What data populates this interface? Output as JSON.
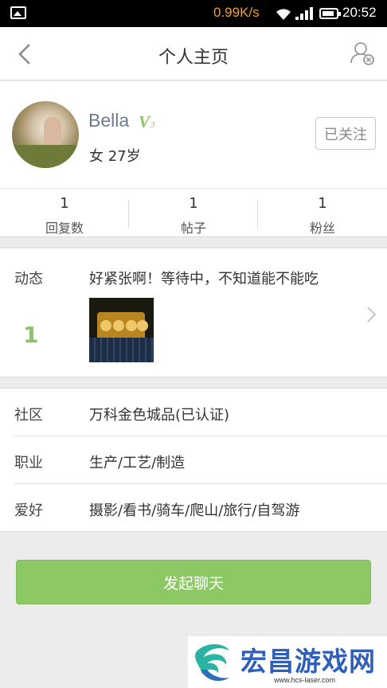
{
  "status_bar": {
    "speed": "0.99K/s",
    "time": "20:52",
    "icons": [
      "photo-icon",
      "wifi-icon",
      "signal-icon",
      "battery-icon"
    ]
  },
  "header": {
    "title": "个人主页",
    "back_icon": "chevron-left-icon",
    "right_icon": "user-settings-icon"
  },
  "profile": {
    "name": "Bella",
    "vip_letter": "V",
    "vip_level": "3",
    "gender_age": "女  27岁",
    "follow_label": "已关注"
  },
  "stats": [
    {
      "value": "1",
      "label": "回复数"
    },
    {
      "value": "1",
      "label": "帖子"
    },
    {
      "value": "1",
      "label": "粉丝"
    }
  ],
  "feed": {
    "label": "动态",
    "count": "1",
    "text": "好紧张啊！等待中，不知道能不能吃"
  },
  "info": [
    {
      "key": "社区",
      "value": "万科金色城品(已认证)"
    },
    {
      "key": "职业",
      "value": "生产/工艺/制造"
    },
    {
      "key": "爱好",
      "value": "摄影/看书/骑车/爬山/旅行/自驾游"
    }
  ],
  "chat_button": "发起聊天",
  "watermark": {
    "title": "宏昌游戏网",
    "url": "www.hcs-laser.com"
  },
  "colors": {
    "accent_green": "#8cc864",
    "name_color": "#6b7a90",
    "status_speed": "#f0a020",
    "watermark_blue": "#2f5fb8"
  }
}
